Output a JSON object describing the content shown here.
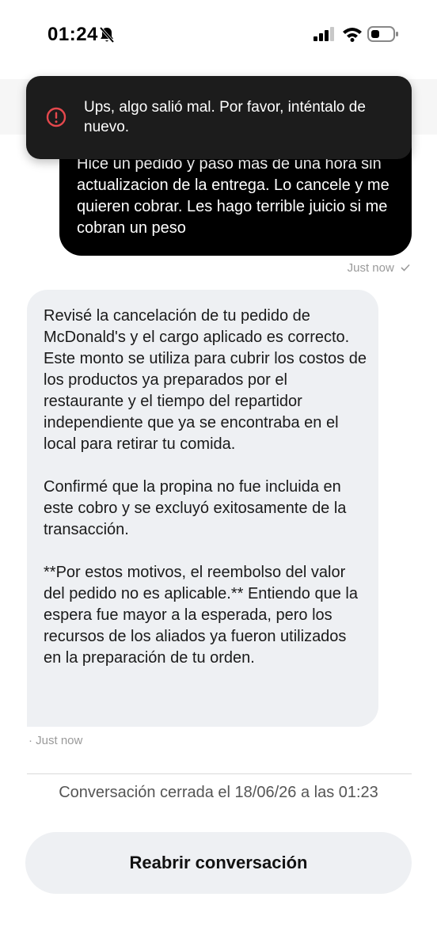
{
  "status_bar": {
    "time": "01:24"
  },
  "toast": {
    "message": "Ups, algo salió mal. Por favor, inténtalo de nuevo."
  },
  "user_message": {
    "text": "Hice un pedido y paso mas de una hora sin actualizacion de la entrega. Lo cancele y me quieren cobrar. Les hago terrible juicio si me cobran un peso",
    "timestamp": "Just now",
    "status_icon": "checkmark-icon"
  },
  "bot_message": {
    "paragraphs": [
      "Revisé la cancelación de tu pedido de McDonald's y el cargo aplicado es correcto. Este monto se utiliza para cubrir los costos de los productos ya preparados por el restaurante y el tiempo del repartidor independiente que ya se encontraba en el local para retirar tu comida.",
      "Confirmé que la propina no fue incluida en este cobro y se excluyó exitosamente de la transacción.",
      "**Por estos motivos, el reembolso del valor del pedido no es aplicable.** Entiendo que la espera fue mayor a la esperada, pero los recursos de los aliados ya fueron utilizados en la preparación de tu orden."
    ],
    "timestamp": "· Just now"
  },
  "conversation": {
    "closed_text": "Conversación cerrada el 18/06/26 a las 01:23",
    "reopen_label": "Reabrir conversación"
  },
  "colors": {
    "toast_icon": "#e5484d",
    "bubble_user": "#000000",
    "bubble_bot": "#eef0f3"
  }
}
